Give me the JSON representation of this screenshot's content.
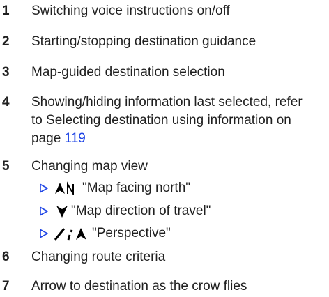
{
  "items": [
    {
      "number": "1",
      "text": "Switching voice instructions on/off"
    },
    {
      "number": "2",
      "text": "Starting/stopping destination guidance"
    },
    {
      "number": "3",
      "text": "Map-guided destination selection"
    },
    {
      "number": "4",
      "text": "Showing/hiding information last selected, refer to Selecting destination using infor­mation on page ",
      "link": "119"
    },
    {
      "number": "5",
      "text": "Changing map view"
    },
    {
      "number": "6",
      "text": "Changing route criteria"
    },
    {
      "number": "7",
      "text": "Arrow to destination as the crow flies"
    }
  ],
  "map_views": [
    {
      "icon": "map-north-icon",
      "label": "\"Map facing north\""
    },
    {
      "icon": "map-direction-of-travel-icon",
      "label": "\"Map direction of travel\""
    },
    {
      "icon": "perspective-icon",
      "label": "\"Perspective\""
    }
  ],
  "colors": {
    "text": "#1f1f1f",
    "link": "#1f45e6",
    "bullet": "#1f45e6"
  }
}
